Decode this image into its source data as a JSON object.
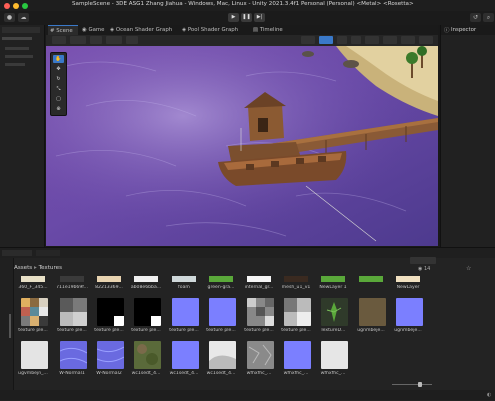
{
  "window": {
    "title": "SampleScene - 3DE ASG1 Zhang Jiahua - Windows, Mac, Linux - Unity 2021.3.4f1 Personal (Personal) <Metal> <Rosetta>"
  },
  "toolbar": {
    "play_icon": "▶",
    "pause_icon": "❚❚",
    "step_icon": "▶|"
  },
  "tabs": [
    {
      "label": "Scene",
      "icon": "grid"
    },
    {
      "label": "Game",
      "icon": "gamepad"
    },
    {
      "label": "Ocean Shader Graph",
      "icon": "graph"
    },
    {
      "label": "Pool Shader Graph",
      "icon": "graph"
    },
    {
      "label": "Timeline",
      "icon": "timeline"
    }
  ],
  "inspector": {
    "title": "Inspector"
  },
  "project": {
    "breadcrumb": [
      "Assets",
      "Textures"
    ],
    "asset_count": "14",
    "row1_labels": [
      "360_F_345...",
      "711e19b69f...",
      "82213369...",
      "ab08e6bba...",
      "foam",
      "green-gra...",
      "internal_gr...",
      "mesh_u1_v1",
      "NewLayer 1",
      "NewLayer"
    ],
    "row2_labels": [
      "texture ple...",
      "texture ple...",
      "texture ple...",
      "texture ple...",
      "texture ple...",
      "texture ple...",
      "texture ple...",
      "texture ple...",
      "TextureD...",
      "ugnmbeje...",
      "ugnmbeje..."
    ],
    "row3_labels": [
      "ugvmbejn_...",
      "W-Normal1",
      "W-Normal2",
      "wc1sedt_4...",
      "wc1sedt_4...",
      "wc1sedt_4...",
      "wfhxfhc_...",
      "wfhxfhc_...",
      "wfhxfhc_..."
    ]
  },
  "colors": {
    "accent": "#3a79c9",
    "panel": "#232323",
    "normal_map": "#7b7fff"
  }
}
